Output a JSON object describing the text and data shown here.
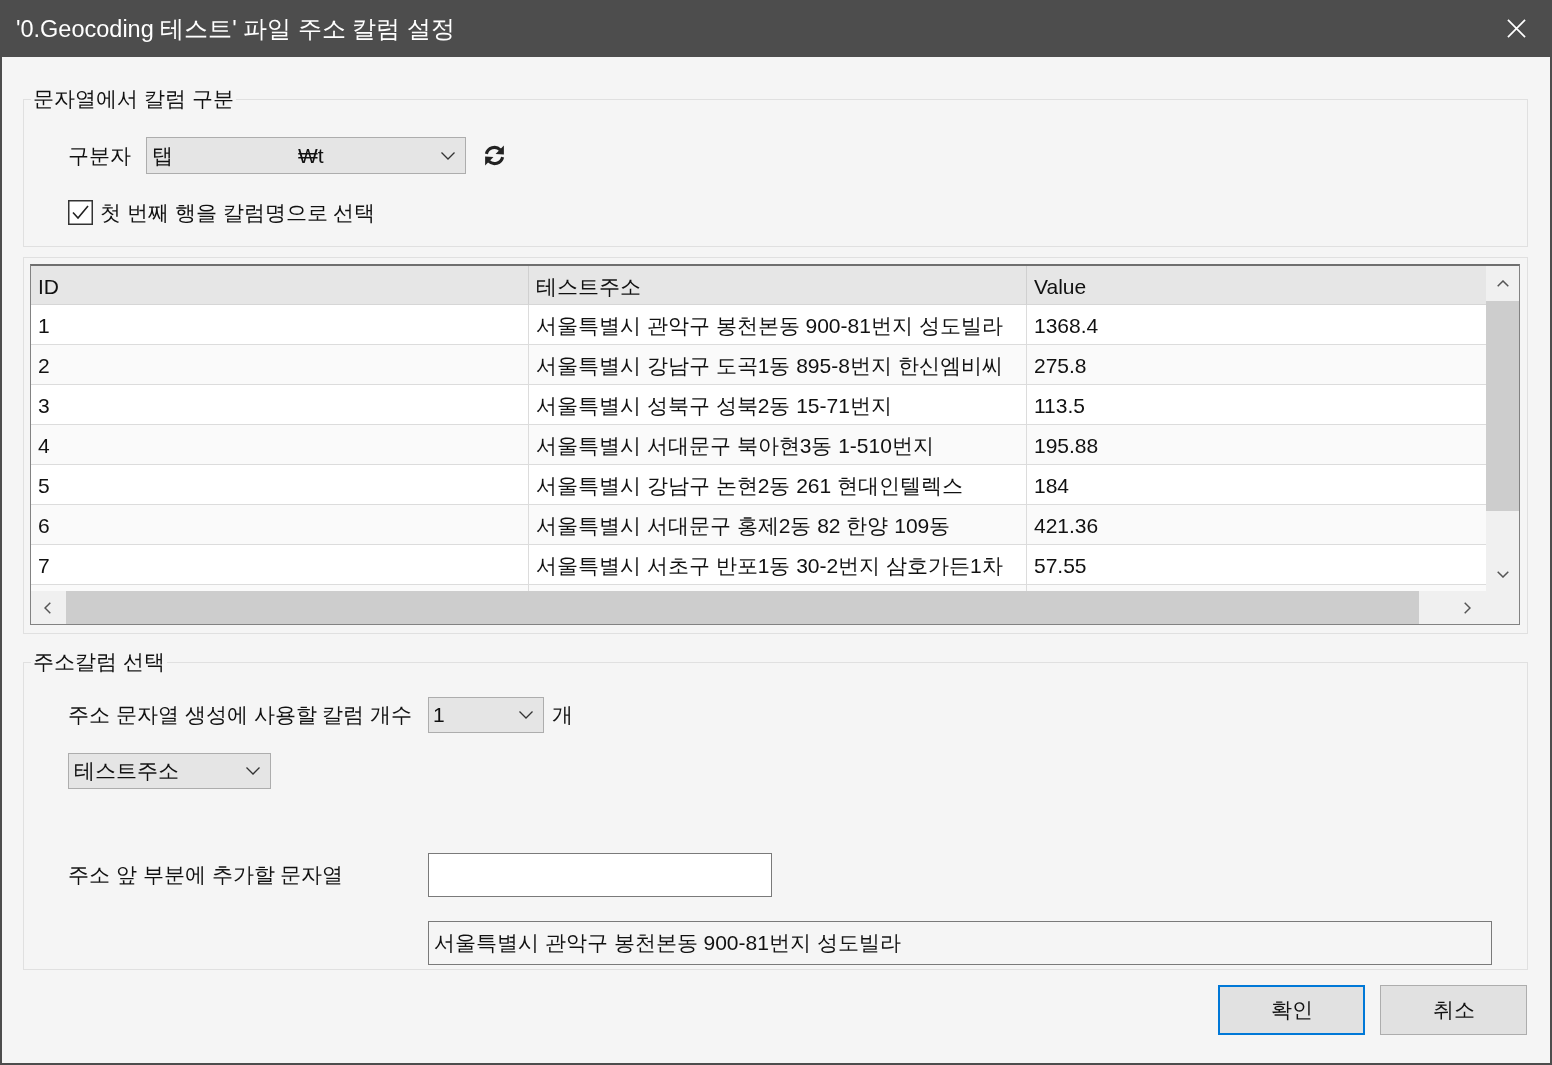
{
  "window": {
    "title": "'0.Geocoding 테스트' 파일 주소 칼럼 설정"
  },
  "delimiter_group": {
    "title": "문자열에서 칼럼 구분",
    "label": "구분자",
    "dropdown": {
      "value": "탭",
      "code": "₩t"
    },
    "first_row_as_header": {
      "label": "첫 번째 행을 칼럼명으로 선택",
      "checked": true
    }
  },
  "table": {
    "columns": [
      "ID",
      "테스트주소",
      "Value"
    ],
    "rows": [
      [
        "1",
        "서울특별시 관악구 봉천본동 900-81번지 성도빌라",
        "1368.4"
      ],
      [
        "2",
        "서울특별시 강남구 도곡1동 895-8번지 한신엠비씨",
        "275.8"
      ],
      [
        "3",
        "서울특별시 성북구 성북2동 15-71번지",
        "113.5"
      ],
      [
        "4",
        "서울특별시 서대문구 북아현3동 1-510번지",
        "195.88"
      ],
      [
        "5",
        "서울특별시 강남구 논현2동 261 현대인텔렉스",
        "184"
      ],
      [
        "6",
        "서울특별시 서대문구 홍제2동 82 한양 109동",
        "421.36"
      ],
      [
        "7",
        "서울특별시 서초구 반포1동 30-2번지 삼호가든1차",
        "57.55"
      ]
    ]
  },
  "address_group": {
    "title": "주소칼럼 선택",
    "count_label": "주소 문자열 생성에 사용할 칼럼 개수",
    "count_value": "1",
    "count_unit": "개",
    "column_dropdowns": [
      "테스트주소"
    ],
    "prefix_label": "주소 앞 부분에 추가할 문자열",
    "preview": "서울특별시 관악구 봉천본동 900-81번지 성도빌라"
  },
  "buttons": [
    {
      "label": "확인",
      "focused": true
    },
    {
      "label": "취소",
      "focused": false
    }
  ]
}
